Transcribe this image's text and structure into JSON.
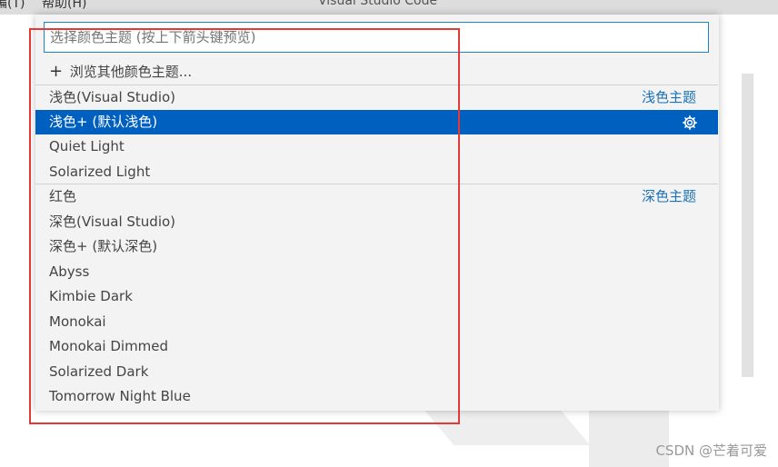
{
  "menubar": {
    "item_1": "编(T)",
    "item_2": "帮助(H)",
    "window_title": "Visual Studio Code"
  },
  "quick_pick": {
    "placeholder": "选择颜色主题 (按上下箭头键预览)",
    "browse_label": "浏览其他颜色主题...",
    "items": [
      {
        "label": "浅色(Visual Studio)",
        "group": "浅色主题"
      },
      {
        "label": "浅色+ (默认浅色)",
        "selected": true,
        "icon": "gear-icon"
      },
      {
        "label": "Quiet Light"
      },
      {
        "label": "Solarized Light"
      },
      {
        "label": "红色",
        "group": "深色主题"
      },
      {
        "label": "深色(Visual Studio)"
      },
      {
        "label": "深色+ (默认深色)"
      },
      {
        "label": "Abyss"
      },
      {
        "label": "Kimbie Dark"
      },
      {
        "label": "Monokai"
      },
      {
        "label": "Monokai Dimmed"
      },
      {
        "label": "Solarized Dark"
      },
      {
        "label": "Tomorrow Night Blue"
      }
    ]
  },
  "watermark": "CSDN @芒着可爱",
  "colors": {
    "selection": "#0060c0",
    "group_label": "#1a72b8",
    "focus_border": "#1a85c7",
    "annotation_box": "#e53935"
  }
}
